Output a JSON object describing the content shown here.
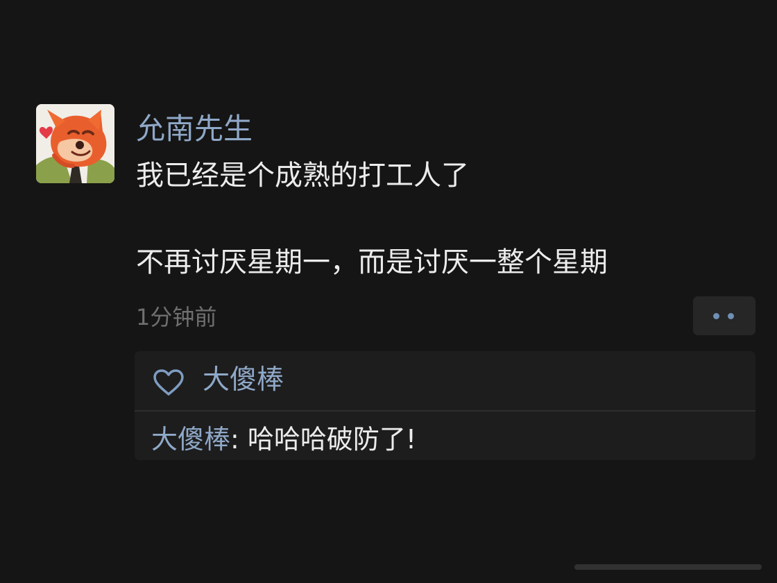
{
  "post": {
    "username": "允南先生",
    "text_line_1": "我已经是个成熟的打工人了",
    "text_line_2": "不再讨厌星期一，而是讨厌一整个星期",
    "timestamp": "1分钟前",
    "avatar_icon": "fox-avatar-icon"
  },
  "likes": {
    "names": "大傻棒",
    "icon": "heart-icon"
  },
  "comment": {
    "author": "大傻棒",
    "separator": ": ",
    "text": "哈哈哈破防了!"
  },
  "more_button": {
    "icon": "more-dots-icon"
  },
  "colors": {
    "background": "#151515",
    "name_blue": "#8fa8c8",
    "text_main": "#ececec",
    "timestamp": "#6f6f6f",
    "panel": "#1d1d1d"
  }
}
